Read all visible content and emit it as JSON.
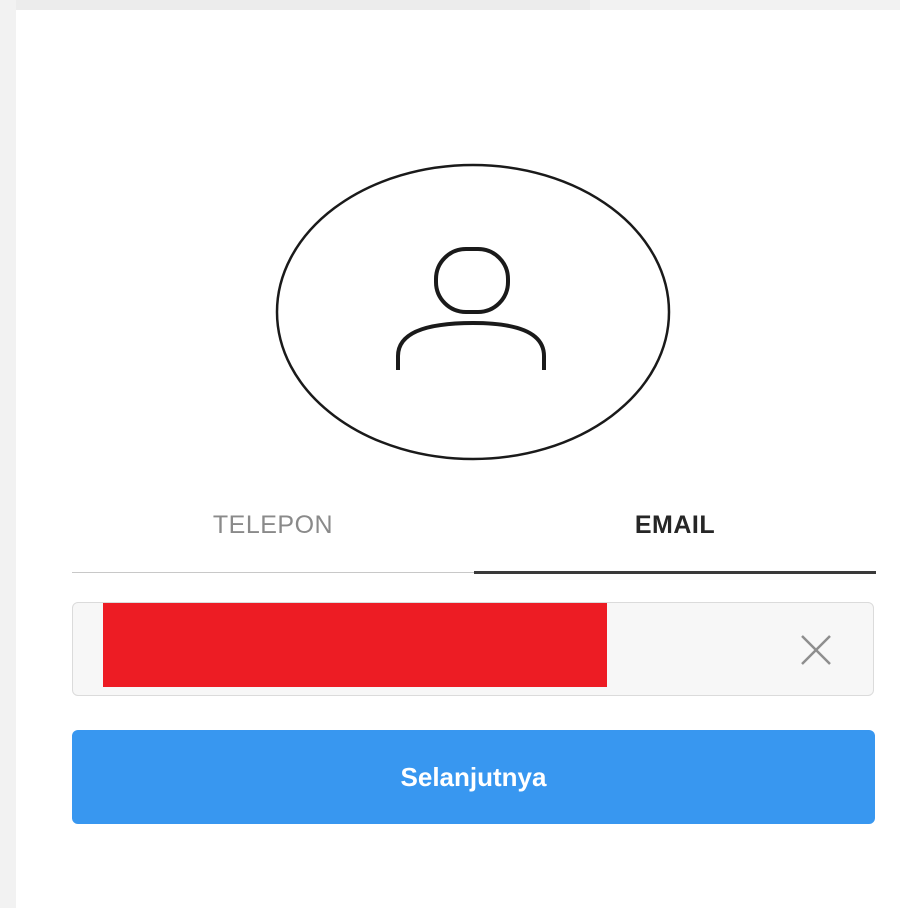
{
  "avatar": {
    "icon": "user-silhouette-icon"
  },
  "tabs": [
    {
      "label": "TELEPON",
      "active": false
    },
    {
      "label": "EMAIL",
      "active": true
    }
  ],
  "email_field": {
    "value": "",
    "redaction_color": "#ed1c24",
    "clear_icon": "close-icon"
  },
  "next_button": {
    "label": "Selanjutnya",
    "color": "#3897f0"
  }
}
